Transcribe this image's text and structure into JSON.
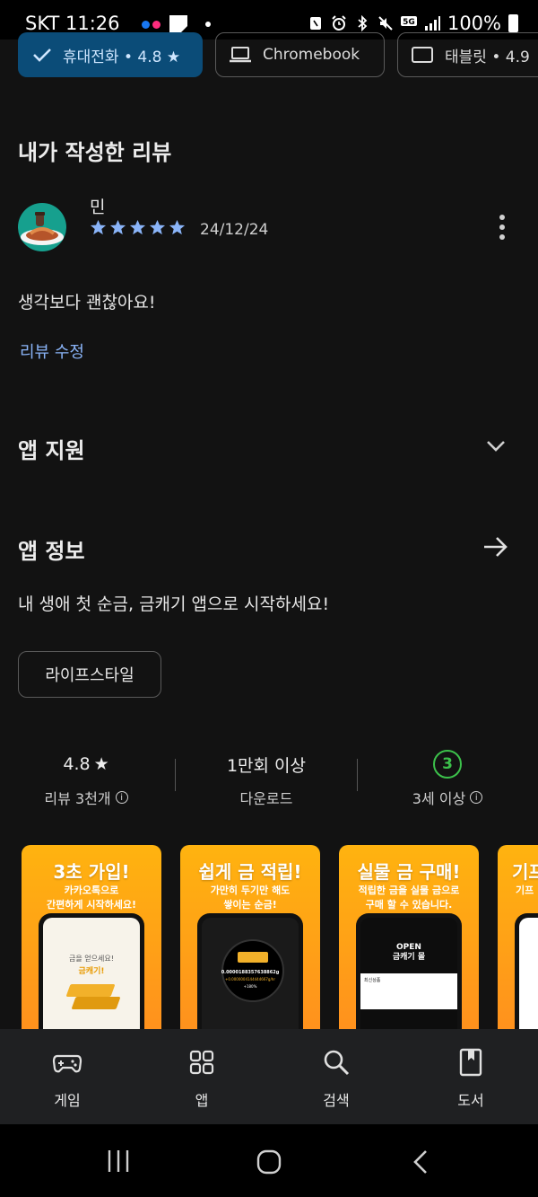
{
  "status_bar": {
    "time": "SKT 11:26",
    "battery": "100%",
    "network": "5G"
  },
  "device_chips": [
    {
      "label": "휴대전화 • 4.8 ★",
      "selected": true
    },
    {
      "label": "Chromebook",
      "selected": false
    },
    {
      "label": "태블릿 • 4.9",
      "selected": false
    }
  ],
  "my_review": {
    "section_title": "내가 작성한 리뷰",
    "reviewer_name": "민",
    "rating": 5,
    "date": "24/12/24",
    "text": "생각보다 괜찮아요!",
    "edit_label": "리뷰 수정"
  },
  "app_support": {
    "title": "앱 지원"
  },
  "app_info": {
    "title": "앱 정보",
    "description": "내 생애 첫 순금, 금캐기 앱으로 시작하세요!",
    "category": "라이프스타일"
  },
  "stats": {
    "rating": "4.8",
    "rating_label": "리뷰 3천개",
    "downloads": "1만회 이상",
    "downloads_label": "다운로드",
    "age": "3",
    "age_label": "3세 이상"
  },
  "screenshots": [
    {
      "title": "3초 가입!",
      "subtitle": "카카오톡으로\n간편하게 시작하세요!",
      "screen_text": "금을 얻으세요!",
      "screen_brand": "금캐기!"
    },
    {
      "title": "쉽게 금 적립!",
      "subtitle": "가만히 두기만 해도\n쌓이는 순금!",
      "screen_value": "0.0000188357638862g",
      "screen_sub": "+0.0000004144444667g/hr",
      "screen_note": "+180%"
    },
    {
      "title": "실물 금 구매!",
      "subtitle": "적립한 금을 실물 금으로\n구매 할 수 있습니다.",
      "screen_banner": "OPEN\n금캐기 몰",
      "screen_tab": "최신상품"
    },
    {
      "title": "기프",
      "subtitle": "기프"
    }
  ],
  "bottom_nav": [
    {
      "label": "게임",
      "icon": "gamepad-icon"
    },
    {
      "label": "앱",
      "icon": "apps-grid-icon"
    },
    {
      "label": "검색",
      "icon": "search-icon"
    },
    {
      "label": "도서",
      "icon": "book-icon"
    }
  ],
  "colors": {
    "background": "#121212",
    "accent_blue": "#8ab4f8",
    "star_blue": "#8ab4f8",
    "selected_chip": "#0b4c78",
    "age_green": "#3cc14b",
    "screenshot_orange": "#ffa319"
  }
}
